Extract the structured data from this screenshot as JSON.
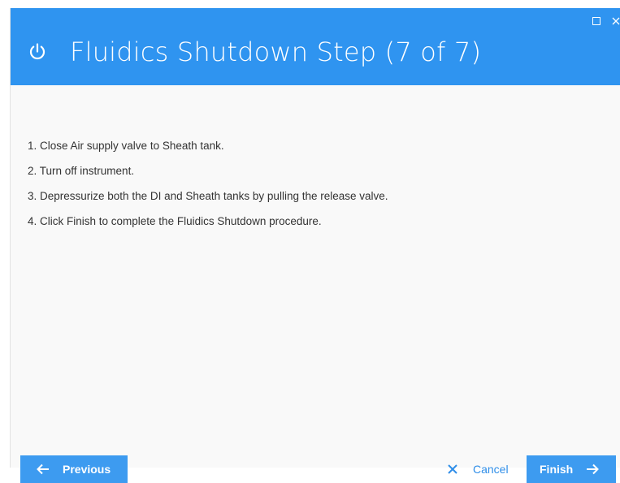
{
  "window": {
    "title": "Fluidics Shutdown Step (7 of 7)",
    "controls": {
      "maximize_icon": "maximize-icon",
      "close_icon": "close-icon"
    },
    "title_icon": "power-icon"
  },
  "instructions": [
    "1. Close Air supply valve to Sheath tank.",
    "2. Turn off instrument.",
    "3. Depressurize both the DI and Sheath tanks by pulling the release valve.",
    "4. Click Finish to complete the Fluidics Shutdown procedure."
  ],
  "footer": {
    "previous_label": "Previous",
    "cancel_label": "Cancel",
    "finish_label": "Finish"
  },
  "colors": {
    "header": "#2f94f0",
    "button": "#3d9bf0",
    "link": "#2f8ee8",
    "background": "#f9f9f9"
  }
}
